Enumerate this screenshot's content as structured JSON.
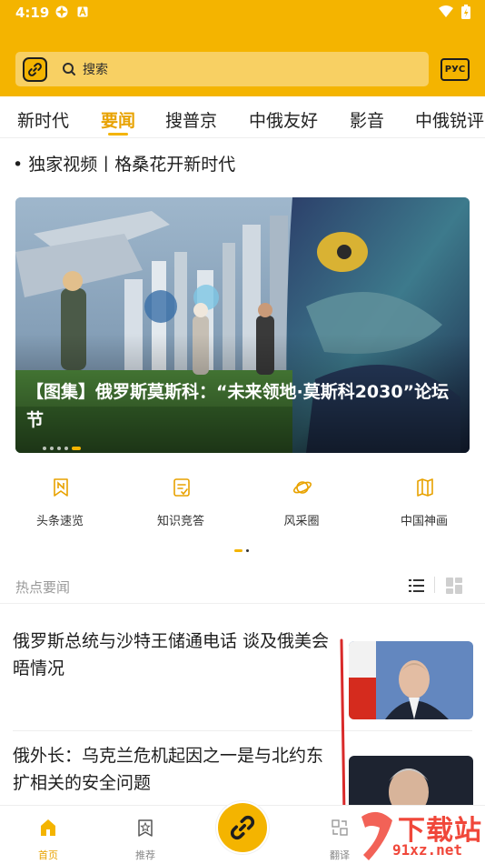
{
  "status_bar": {
    "time": "4:19"
  },
  "search": {
    "placeholder": "搜索",
    "lang_button": "РУС"
  },
  "tabs": [
    {
      "label": "新时代"
    },
    {
      "label": "要闻"
    },
    {
      "label": "搜普京"
    },
    {
      "label": "中俄友好"
    },
    {
      "label": "影音"
    },
    {
      "label": "中俄锐评"
    }
  ],
  "headline": "• 独家视频丨格桑花开新时代",
  "banner": {
    "caption": "【图集】俄罗斯莫斯科：“未来领地·莫斯科2030”论坛节"
  },
  "quick_menu": [
    {
      "label": "头条速览",
      "icon": "bookmark-n-icon"
    },
    {
      "label": "知识竞答",
      "icon": "quiz-icon"
    },
    {
      "label": "风采圈",
      "icon": "planet-icon"
    },
    {
      "label": "中国神画",
      "icon": "map-scroll-icon"
    }
  ],
  "section": {
    "title": "热点要闻"
  },
  "news": [
    {
      "title": "俄罗斯总统与沙特王储通电话 谈及俄美会晤情况"
    },
    {
      "title": "俄外长：乌克兰危机起因之一是与北约东扩相关的安全问题"
    }
  ],
  "bottom_nav": [
    {
      "label": "首页",
      "icon": "home-icon"
    },
    {
      "label": "推荐",
      "icon": "star-icon"
    },
    {
      "label": "翻译",
      "icon": "translate-icon"
    }
  ],
  "watermark": {
    "line1": "下载站",
    "line2": "91xz.net"
  },
  "colors": {
    "accent": "#f4b400",
    "active_text": "#e8a200",
    "watermark": "#f0473a"
  }
}
